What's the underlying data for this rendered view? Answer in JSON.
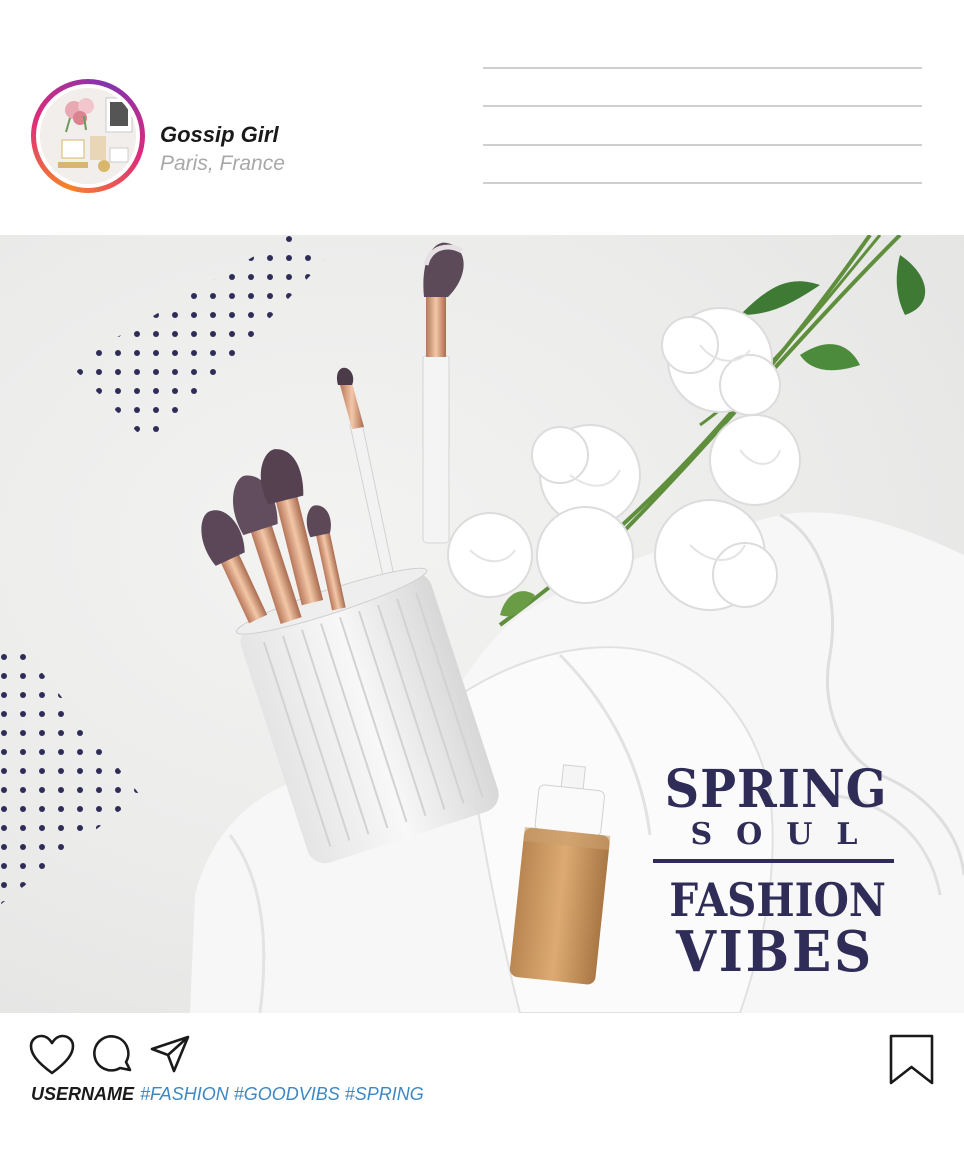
{
  "post": {
    "account_name": "Gossip Girl",
    "location": "Paris, France"
  },
  "image": {
    "headline_line1": "SPRING",
    "headline_line2": "SOUL",
    "headline_line3": "FASHION",
    "headline_line4": "VIBES"
  },
  "caption": {
    "username": "USERNAME",
    "hashtags": "#FASHION #GOODVIBS #SPRING"
  },
  "colors": {
    "headline": "#2f2d57",
    "hashtag": "#3d87c4",
    "avatar_ring_start": "#f58529",
    "avatar_ring_end": "#8134af"
  },
  "icons": [
    "heart-icon",
    "comment-icon",
    "share-icon",
    "bookmark-icon"
  ]
}
